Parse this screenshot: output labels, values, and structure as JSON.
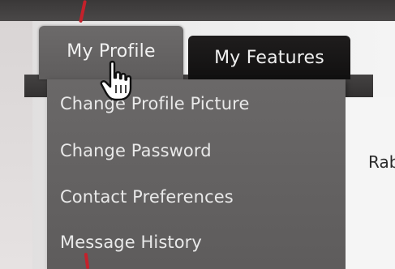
{
  "tabs": [
    {
      "label": "My Profile",
      "active": true
    },
    {
      "label": "My Features",
      "active": false
    }
  ],
  "dropdown": {
    "items": [
      {
        "label": "Change Profile Picture"
      },
      {
        "label": "Change Password"
      },
      {
        "label": "Contact Preferences"
      },
      {
        "label": "Message History"
      }
    ]
  },
  "content": {
    "partial_text": "Rab"
  },
  "cursor": {
    "type": "hand-pointer-icon"
  },
  "colors": {
    "tab_active": "#666464",
    "tab_inactive": "#151414",
    "dropdown": "#646262",
    "menu_text": "#e9e9e9",
    "annotation_red": "#c4212b"
  }
}
